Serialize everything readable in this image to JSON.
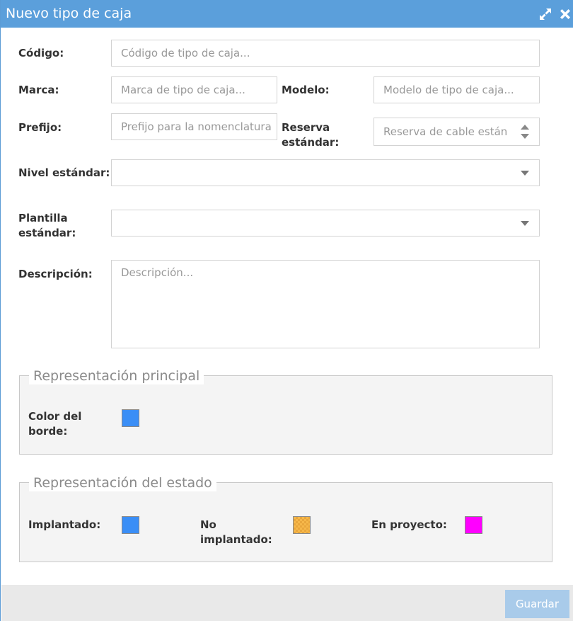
{
  "dialog": {
    "title": "Nuevo tipo de caja",
    "title_bg": "#5b9fdb"
  },
  "form": {
    "codigo": {
      "label": "Código:",
      "placeholder": "Código de tipo de caja..."
    },
    "marca": {
      "label": "Marca:",
      "placeholder": "Marca de tipo de caja..."
    },
    "modelo": {
      "label": "Modelo:",
      "placeholder": "Modelo de tipo de caja..."
    },
    "prefijo": {
      "label": "Prefijo:",
      "placeholder": "Prefijo para la nomenclatura"
    },
    "reserva": {
      "label_line1": "Reserva",
      "label_line2": "estándar:",
      "placeholder": "Reserva de cable están"
    },
    "nivel": {
      "label": "Nivel estándar:",
      "value": ""
    },
    "plantilla": {
      "label_line1": "Plantilla",
      "label_line2": "estándar:",
      "value": ""
    },
    "descripcion": {
      "label": "Descripción:",
      "placeholder": "Descripción..."
    }
  },
  "principal": {
    "legend": "Representación principal",
    "color_borde": {
      "label_line1": "Color del",
      "label_line2": "borde:",
      "color": "#3a8ef6"
    }
  },
  "estado": {
    "legend": "Representación del estado",
    "implantado": {
      "label": "Implantado:",
      "color": "#3a8ef6"
    },
    "no_implantado": {
      "label_line1": "No",
      "label_line2": "implantado:",
      "color": "#f6b84a"
    },
    "en_proyecto": {
      "label": "En proyecto:",
      "color": "#ff00ff"
    }
  },
  "footer": {
    "save_label": "Guardar"
  },
  "icons": {
    "expand": "expand-icon",
    "close": "close-icon",
    "dropdown": "chevron-down-icon",
    "spinner": "spinner-arrows-icon"
  }
}
